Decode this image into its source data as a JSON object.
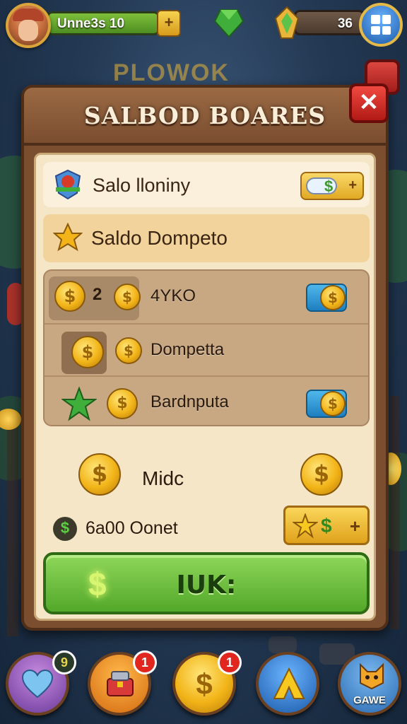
{
  "hud": {
    "player_name": "Unne3s 10",
    "plus": "+",
    "coins": "36"
  },
  "background": {
    "ghost_title": "PLOWOK"
  },
  "panel": {
    "title": "SALBOD BOARES",
    "close": "✕"
  },
  "rows": {
    "top": {
      "label": "Salo lloniny",
      "pill_symbol": "$",
      "pill_plus": "+"
    },
    "highlight": {
      "label": "Saldo Dompeto"
    }
  },
  "list": [
    {
      "number": "2",
      "label": "4YKO"
    },
    {
      "label": "Dompetta"
    },
    {
      "label": "Bardnputa"
    }
  ],
  "reward": {
    "middle_label": "Midc",
    "bottom_label": "6a00 Oonet",
    "badge": "$",
    "pill_symbol": "$",
    "pill_plus": "+"
  },
  "ok_button": {
    "label": "IUK:",
    "icon": "$"
  },
  "nav": [
    {
      "icon": "heart-icon",
      "badge": "9"
    },
    {
      "icon": "chest-icon",
      "badge": "1"
    },
    {
      "icon": "coin-icon",
      "badge": "1"
    },
    {
      "icon": "arrow-up-icon"
    },
    {
      "icon": "cat-icon",
      "label": "GAWE"
    }
  ],
  "colors": {
    "accent_green": "#52a82a",
    "accent_gold": "#f2b418",
    "close_red": "#b21a16",
    "panel_brown": "#7b4e30"
  }
}
